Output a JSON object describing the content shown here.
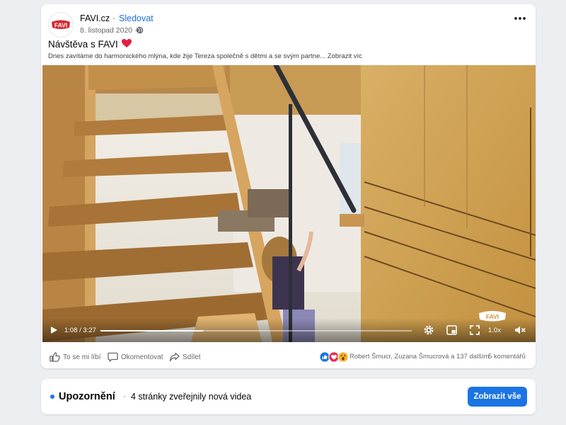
{
  "post": {
    "page_name": "FAVI.cz",
    "separator": "·",
    "follow_label": "Sledovat",
    "date": "8. listopad 2020 ·",
    "title": "Návštěva s FAVI",
    "text": "Dnes zavítáme do harmonického mlýna, kde žije Tereza společně s dětmi a se svým partne...",
    "see_more": "Zobrazit víc",
    "avatar_logo_text": "FAVI"
  },
  "video": {
    "time": "1:08 / 3:27",
    "progress": 0.33,
    "speed": "1.0x",
    "watermark_text": "FAVI"
  },
  "actions": {
    "like": "To se mi líbí",
    "comment": "Okomentovat",
    "share": "Sdílet",
    "reactors": "Robert Šmucr, Zuzana Šmucrová a 137 dalším",
    "comments_count": "5 komentářů"
  },
  "notification": {
    "title": "Upozornění",
    "separator": "·",
    "text": "4 stránky zveřejnily nová videa",
    "button": "Zobrazit vše"
  },
  "colors": {
    "accent": "#1b74e4",
    "link": "#216fdb",
    "brand_red": "#d7282f",
    "heart": "#e41e3f"
  },
  "icons": {
    "privacy": "globe-icon",
    "title_emoji": "heart-icon",
    "more": "more-icon",
    "play": "play-icon",
    "settings": "gear-icon",
    "mini_player": "miniplayer-icon",
    "fullscreen": "expand-icon",
    "volume": "speaker-muted-icon",
    "like": "thumbs-up-icon",
    "comment": "comment-icon",
    "share": "share-icon"
  }
}
